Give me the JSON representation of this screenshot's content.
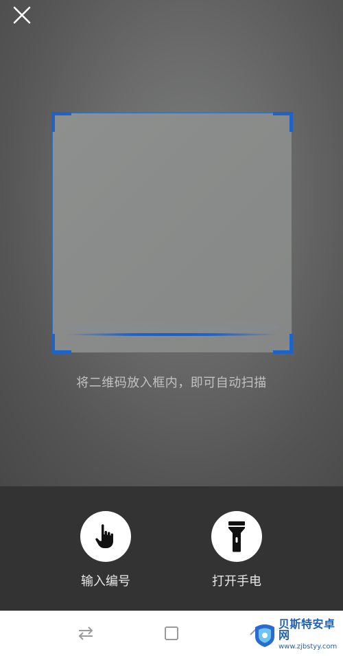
{
  "scanner": {
    "hint": "将二维码放入框内，即可自动扫描",
    "accent_color": "#1d63c8"
  },
  "top_bar": {
    "close_icon": "close-icon"
  },
  "actions": [
    {
      "label": "输入编号",
      "icon": "hand-pointer-icon"
    },
    {
      "label": "打开手电",
      "icon": "flashlight-icon"
    }
  ],
  "nav": {
    "icons": [
      "swap-icon",
      "home-square-icon",
      "back-icon"
    ]
  },
  "watermark": {
    "title": "贝斯特安卓网",
    "url": "www.zjbstyy.com"
  }
}
